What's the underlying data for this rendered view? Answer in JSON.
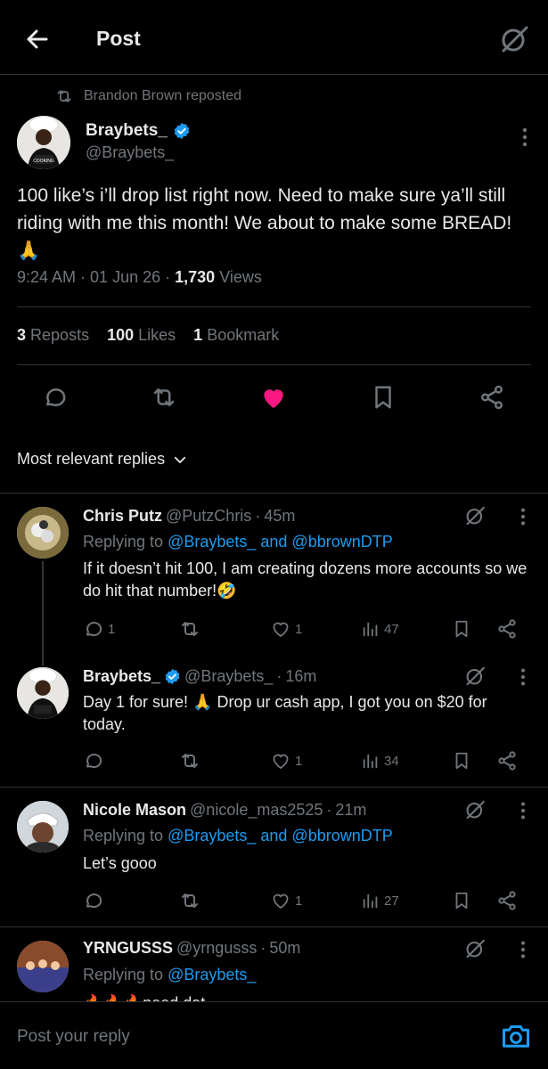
{
  "header": {
    "title": "Post",
    "icons": [
      "back-arrow-icon",
      "grok-icon"
    ]
  },
  "repost": {
    "text": "Brandon Brown reposted"
  },
  "post": {
    "author_name": "Braybets_",
    "handle": "@Braybets_",
    "verified": true,
    "text": "100 like’s i’ll drop list right now. Need to make sure ya’ll still riding with me this month! We about to make some BREAD!🙏",
    "time": "9:24 AM",
    "date": "01 Jun 26",
    "views_count": "1,730",
    "views_label": "Views",
    "reposts_count": "3",
    "reposts_label": "Reposts",
    "likes_count": "100",
    "likes_label": "Likes",
    "bookmarks_count": "1",
    "bookmarks_label": "Bookmark"
  },
  "sort": {
    "label": "Most relevant replies"
  },
  "replies": [
    {
      "name": "Chris Putz",
      "handle": "@PutzChris",
      "time": "45m",
      "replying_label": "Replying to",
      "replying_to": "@Braybets_ and @bbrownDTP",
      "text": "If it doesn’t hit 100, I am creating dozens more accounts so we do hit that number!🤣",
      "replies": "1",
      "likes": "1",
      "views": "47"
    },
    {
      "name": "Braybets_",
      "handle": "@Braybets_",
      "time": "16m",
      "verified": true,
      "text": "Day 1 for sure! 🙏 Drop ur cash app, I got you on $20 for today.",
      "likes": "1",
      "views": "34"
    },
    {
      "name": "Nicole Mason",
      "handle": "@nicole_mas2525",
      "time": "21m",
      "replying_label": "Replying to",
      "replying_to": "@Braybets_ and @bbrownDTP",
      "text": "Let’s gooo",
      "likes": "1",
      "views": "27"
    },
    {
      "name": "YRNGUSSS",
      "handle": "@yrngusss",
      "time": "50m",
      "replying_label": "Replying to",
      "replying_to": "@Braybets_",
      "text": "🔥🔥🔥need dat"
    }
  ],
  "composer": {
    "placeholder": "Post your reply"
  },
  "colors": {
    "accent": "#1d9bf0",
    "like": "#f91880",
    "background": "#000000",
    "muted": "#71767b"
  }
}
